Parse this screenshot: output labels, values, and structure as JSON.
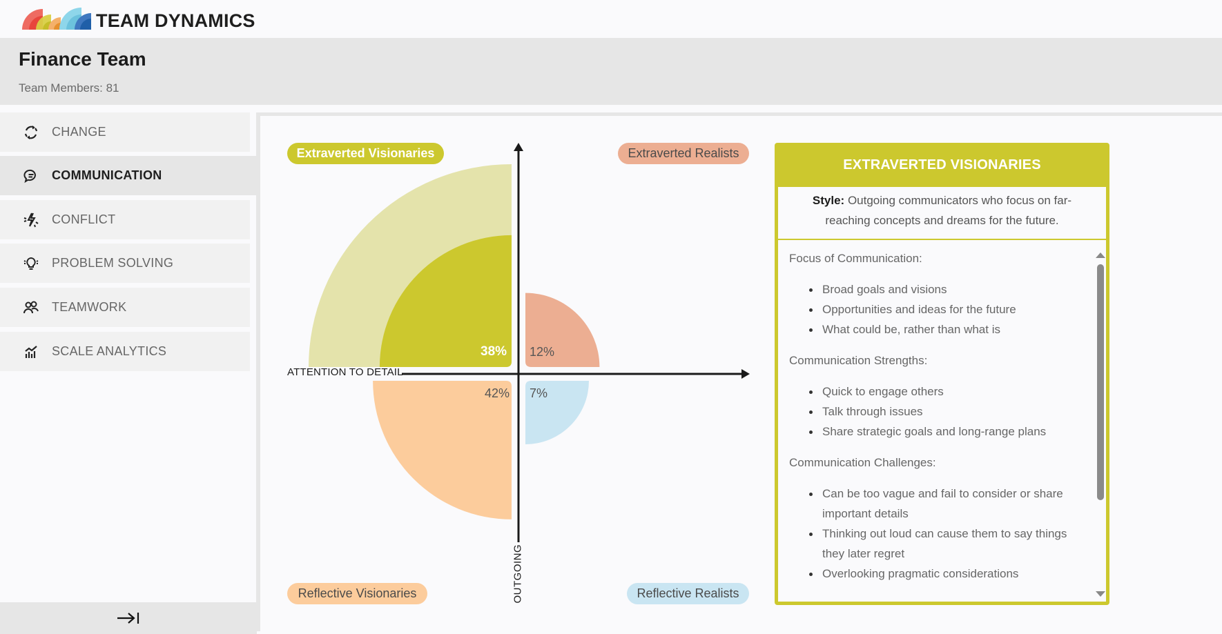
{
  "app": {
    "brand": "TEAM DYNAMICS",
    "logo_colors": [
      "#e8453c",
      "#cfc62e",
      "#f0a04b",
      "#7fcde3",
      "#1f5fa8"
    ]
  },
  "team": {
    "title": "Finance Team",
    "members_label": "Team Members: 81"
  },
  "sidebar": {
    "items": [
      {
        "label": "CHANGE",
        "icon": "refresh-cycle-icon",
        "active": false
      },
      {
        "label": "COMMUNICATION",
        "icon": "chat-bubble-icon",
        "active": true
      },
      {
        "label": "CONFLICT",
        "icon": "lightning-bolt-icon",
        "active": false
      },
      {
        "label": "PROBLEM SOLVING",
        "icon": "lightbulb-icon",
        "active": false
      },
      {
        "label": "TEAMWORK",
        "icon": "people-icon",
        "active": false
      },
      {
        "label": "SCALE ANALYTICS",
        "icon": "analytics-chart-icon",
        "active": false
      }
    ],
    "collapse_icon": "→|"
  },
  "chart_data": {
    "type": "quadrant-area",
    "x_axis_label": "ATTENTION TO DETAIL",
    "y_axis_label": "OUTGOING",
    "selected_quadrant": "Extraverted Visionaries",
    "quadrants": [
      {
        "name": "Extraverted Visionaries",
        "position": "top-left",
        "value": 38,
        "label": "38%",
        "color": "#ccc82e",
        "highlight_color": "#e4e3ab"
      },
      {
        "name": "Extraverted Realists",
        "position": "top-right",
        "value": 12,
        "label": "12%",
        "color": "#ecae92"
      },
      {
        "name": "Reflective Visionaries",
        "position": "bottom-left",
        "value": 42,
        "label": "42%",
        "color": "#fccc9c"
      },
      {
        "name": "Reflective Realists",
        "position": "bottom-right",
        "value": 7,
        "label": "7%",
        "color": "#c9e5f2"
      }
    ]
  },
  "detail": {
    "title": "EXTRAVERTED VISIONARIES",
    "accent": "#ccc82e",
    "style_label": "Style:",
    "style_text": "Outgoing communicators who focus on far-reaching concepts and dreams for the future.",
    "sections": [
      {
        "title": "Focus of Communication:",
        "items": [
          "Broad goals and visions",
          "Opportunities and ideas for the future",
          "What could be, rather than what is"
        ]
      },
      {
        "title": "Communication Strengths:",
        "items": [
          "Quick to engage others",
          "Talk through issues",
          "Share strategic goals and long-range plans"
        ]
      },
      {
        "title": "Communication Challenges:",
        "items": [
          "Can be too vague and fail to consider or share important details",
          "Thinking out loud can cause them to say things they later regret",
          "Overlooking pragmatic considerations"
        ]
      }
    ]
  }
}
